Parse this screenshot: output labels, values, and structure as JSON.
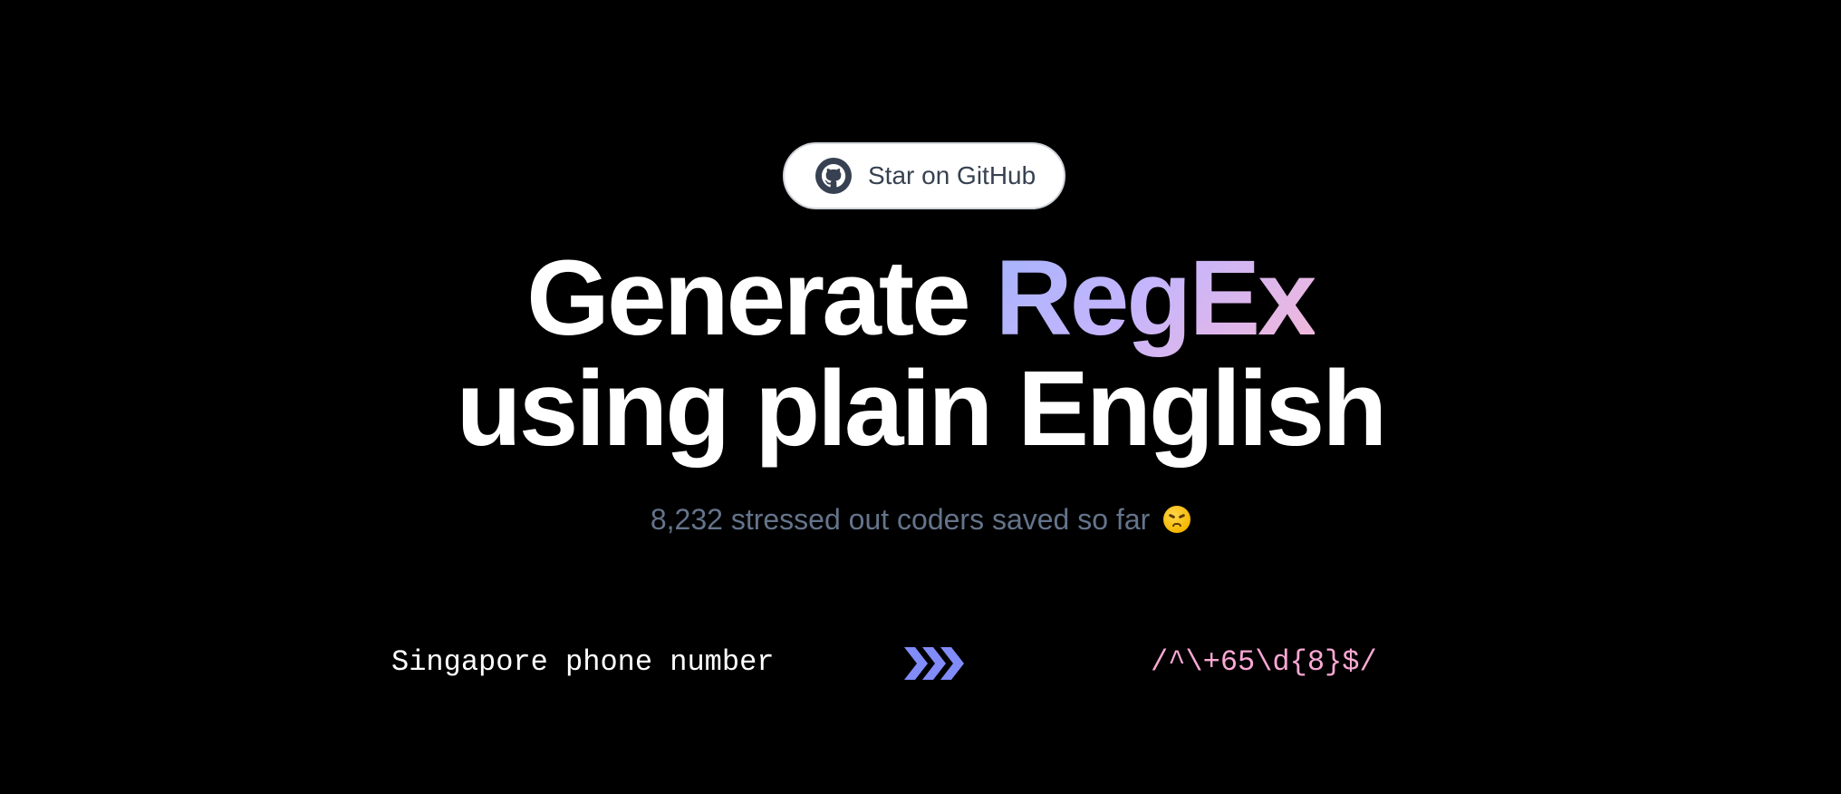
{
  "github_button": {
    "label": "Star on GitHub",
    "icon": "github-icon"
  },
  "hero": {
    "title_part1": "Generate ",
    "title_accent": "RegEx",
    "title_line2": "using plain English"
  },
  "subtitle": {
    "text": "8,232 stressed out coders saved so far ",
    "emoji_icon": "confounded-face-icon"
  },
  "example": {
    "input": "Singapore phone number",
    "arrow_icon": "triple-chevron-right-icon",
    "output": "/^\\+65\\d{8}$/"
  },
  "colors": {
    "background": "#000000",
    "accent_gradient_start": "#a5b4fc",
    "accent_gradient_end": "#f5b8d8",
    "subtitle": "#64748b",
    "arrow": "#818cf8",
    "output": "#f9a8d4"
  }
}
